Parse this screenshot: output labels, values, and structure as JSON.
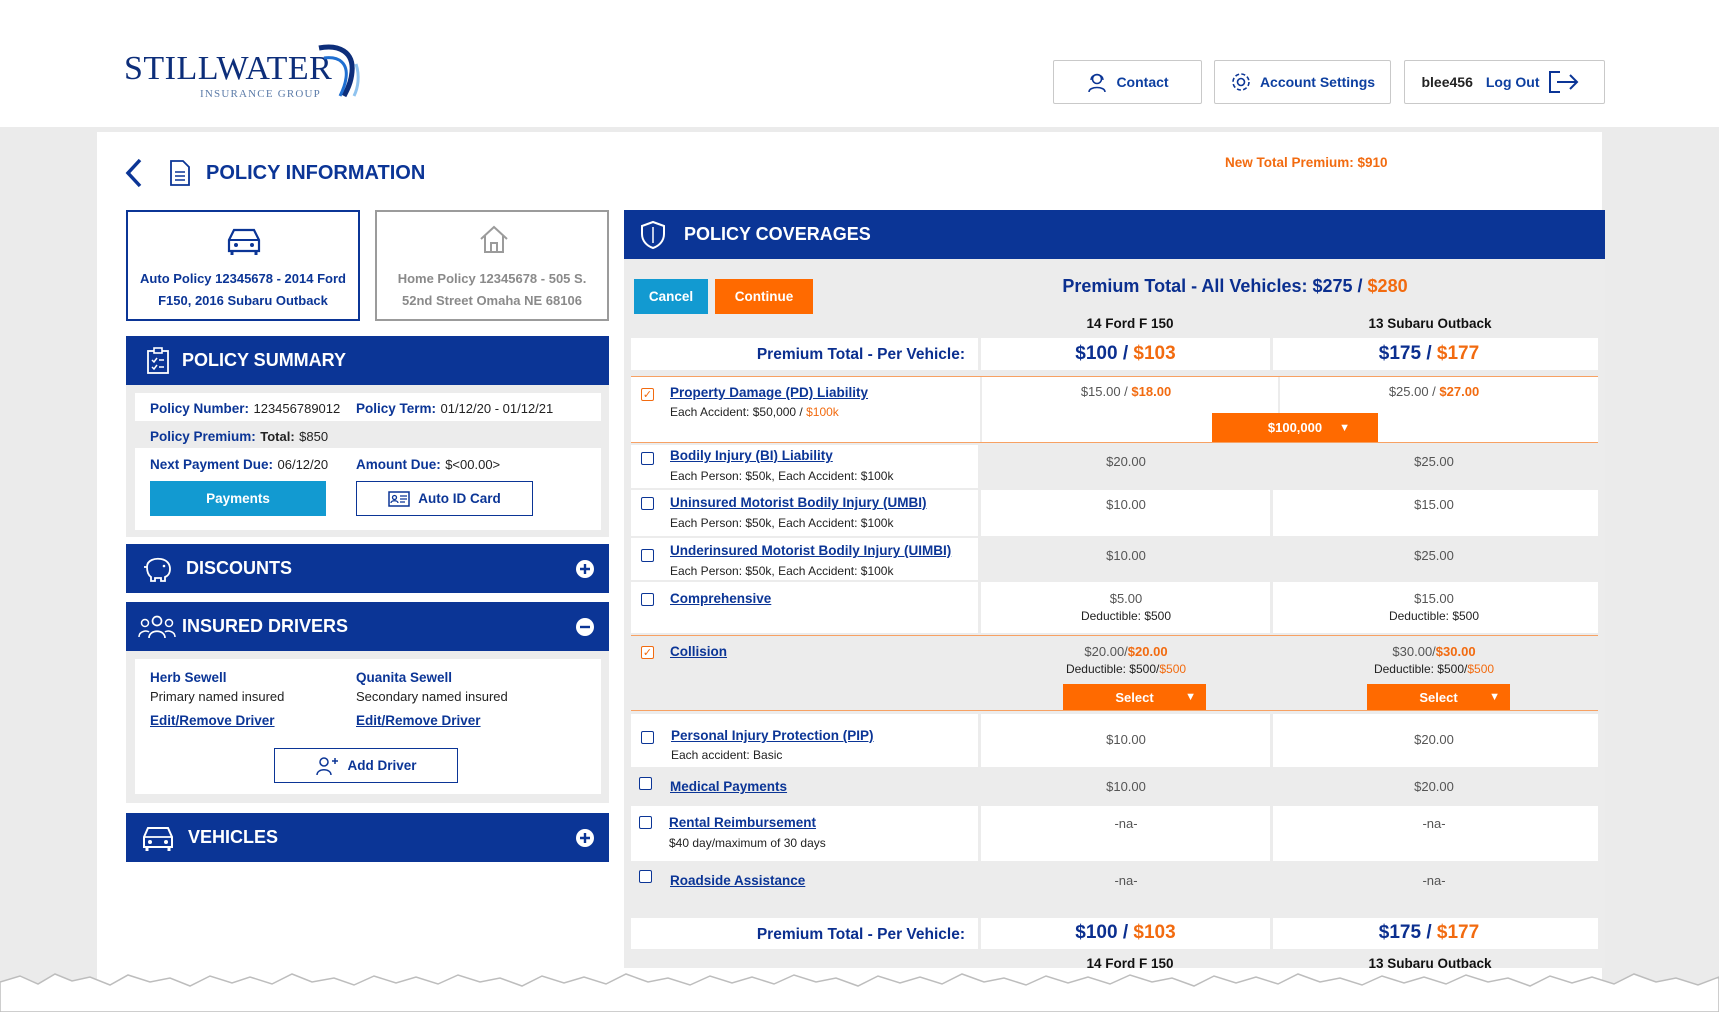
{
  "logo": {
    "name": "STILLWATER",
    "sub": "INSURANCE GROUP"
  },
  "header": {
    "contact": "Contact",
    "account_settings": "Account Settings",
    "username": "blee456",
    "logout": "Log Out"
  },
  "page_title": "POLICY INFORMATION",
  "new_total_premium": "New Total Premium: $910",
  "policies": {
    "auto": "Auto Policy 12345678 - 2014 Ford F150, 2016 Subaru Outback",
    "home": "Home Policy 12345678 - 505 S. 52nd Street Omaha NE 68106"
  },
  "summary": {
    "title": "POLICY SUMMARY",
    "policy_number_label": "Policy Number:",
    "policy_number": "123456789012",
    "policy_term_label": "Policy Term:",
    "policy_term": "01/12/20 - 01/12/21",
    "policy_premium_label": "Policy Premium:",
    "total_label": "Total:",
    "total": "$850",
    "next_payment_label": "Next Payment Due:",
    "next_payment": "06/12/20",
    "amount_due_label": "Amount Due:",
    "amount_due": "$<00.00>",
    "payments_button": "Payments",
    "auto_id_button": "Auto ID Card"
  },
  "discounts": {
    "title": "DISCOUNTS"
  },
  "drivers": {
    "title": "INSURED DRIVERS",
    "list": [
      {
        "name": "Herb Sewell",
        "role": "Primary named insured",
        "edit": "Edit/Remove Driver"
      },
      {
        "name": "Quanita Sewell",
        "role": "Secondary named insured",
        "edit": "Edit/Remove Driver"
      }
    ],
    "add_button": "Add Driver"
  },
  "vehicles": {
    "title": "VEHICLES"
  },
  "coverages": {
    "title": "POLICY COVERAGES",
    "cancel": "Cancel",
    "continue": "Continue",
    "premium_total_label": "Premium Total - All Vehicles:",
    "premium_total_old": "$275",
    "premium_total_new": "$280",
    "vehicle1": "14 Ford F 150",
    "vehicle2": "13 Subaru Outback",
    "per_vehicle_label": "Premium Total - Per Vehicle:",
    "v1_old": "$100",
    "v1_new": "$103",
    "v2_old": "$175",
    "v2_new": "$177",
    "pd": {
      "name": "Property Damage (PD) Liability",
      "sub": "Each Accident: $50,000 / ",
      "sub_new": "$100k",
      "v1_old": "$15.00 / ",
      "v1_new": "$18.00",
      "v2_old": "$25.00 / ",
      "v2_new": "$27.00",
      "select": "$100,000"
    },
    "bi": {
      "name": "Bodily Injury (BI) Liability",
      "sub": "Each Person: $50k, Each Accident: $100k",
      "v1": "$20.00",
      "v2": "$25.00"
    },
    "umbi": {
      "name": "Uninsured Motorist Bodily Injury (UMBI)",
      "sub": "Each Person: $50k, Each Accident: $100k",
      "v1": "$10.00",
      "v2": "$15.00"
    },
    "uimbi": {
      "name": "Underinsured Motorist Bodily Injury (UIMBI)",
      "sub": "Each Person: $50k, Each Accident: $100k",
      "v1": "$10.00",
      "v2": "$25.00"
    },
    "comp": {
      "name": "Comprehensive",
      "v1": "$5.00",
      "v1_ded": "Deductible: $500",
      "v2": "$15.00",
      "v2_ded": "Deductible: $500"
    },
    "coll": {
      "name": "Collision",
      "v1_old": "$20.00/",
      "v1_new": "$20.00",
      "v1_ded_old": "Deductible: $500/",
      "v1_ded_new": "$500",
      "v2_old": "$30.00/",
      "v2_new": "$30.00",
      "v2_ded_old": "Deductible: $500/",
      "v2_ded_new": "$500",
      "select": "Select"
    },
    "pip": {
      "name": "Personal Injury Protection (PIP)",
      "sub": "Each accident: Basic",
      "v1": "$10.00",
      "v2": "$20.00"
    },
    "med": {
      "name": "Medical Payments",
      "v1": "$10.00",
      "v2": "$20.00"
    },
    "rental": {
      "name": "Rental Reimbursement",
      "sub": "$40 day/maximum of 30 days",
      "v1": "-na-",
      "v2": "-na-"
    },
    "road": {
      "name": "Roadside Assistance",
      "v1": "-na-",
      "v2": "-na-"
    }
  }
}
